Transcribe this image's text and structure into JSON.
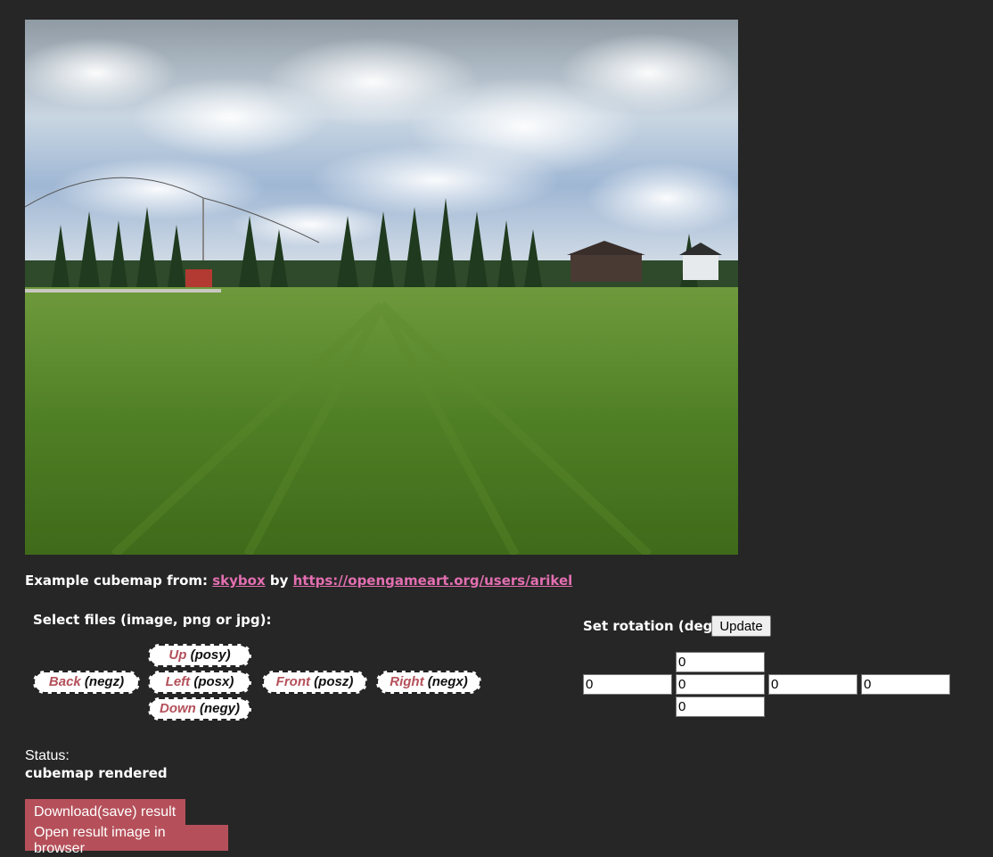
{
  "credits": {
    "prefix": "Example cubemap from:",
    "link1": "skybox",
    "by": "by",
    "link2": "https://opengameart.org/users/arikel"
  },
  "select_label": "Select files (image, png or jpg):",
  "faces": {
    "up": {
      "name": "Up",
      "code": "(posy)"
    },
    "back": {
      "name": "Back",
      "code": "(negz)"
    },
    "left": {
      "name": "Left",
      "code": "(posx)"
    },
    "front": {
      "name": "Front",
      "code": "(posz)"
    },
    "right": {
      "name": "Right",
      "code": "(negx)"
    },
    "down": {
      "name": "Down",
      "code": "(negy)"
    }
  },
  "rotation": {
    "label": "Set rotation (deg):",
    "update_label": "Update",
    "values": {
      "top": "0",
      "left": "0",
      "center": "0",
      "right": "0",
      "far_right": "0",
      "bottom": "0"
    }
  },
  "status": {
    "label": "Status:",
    "value": "cubemap rendered"
  },
  "buttons": {
    "download": "Download(save) result",
    "open": "Open result image in browser"
  }
}
